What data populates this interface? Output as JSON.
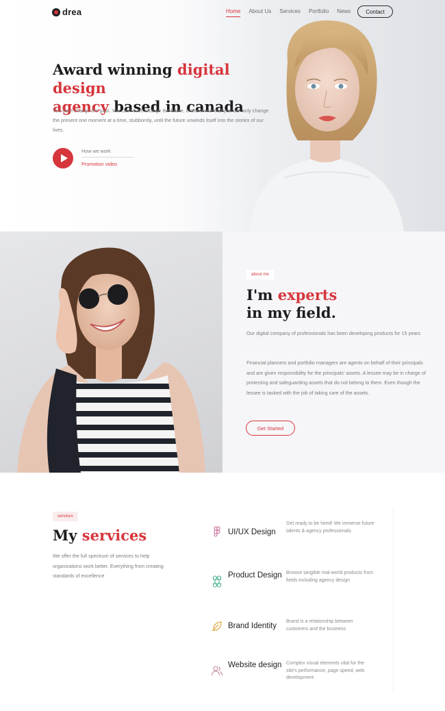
{
  "nav": {
    "logo_text": "drea",
    "items": [
      {
        "label": "Home",
        "active": true
      },
      {
        "label": "About Us",
        "active": false
      },
      {
        "label": "Services",
        "active": false
      },
      {
        "label": "Portfolio",
        "active": false
      },
      {
        "label": "News",
        "active": false
      }
    ],
    "contact_label": "Contact"
  },
  "hero": {
    "title_part1": "Award winning ",
    "title_highlight1": "digital design",
    "title_highlight2": "agency",
    "title_part2": " based in canada",
    "description": "You can't change the past. You can't even change the future, in the sense that you can only change the present one moment at a time, stubbornly, until the future unwinds itself into the stories of our lives.",
    "how_we_work": "How we work",
    "promotion_video": "Promotion video"
  },
  "about": {
    "tag": "about me",
    "title_part1": "I'm ",
    "title_highlight": "experts",
    "title_part2": "in my field.",
    "paragraph1": "Our digital company of professionals has been developing products for 15 years",
    "paragraph2": "Financial planners and portfolio managers are agents on behalf of their principals and are given responsibility for the principals' assets. A lessee may be in charge of protecting and safeguarding assets that do not belong to them. Even though the lessee is tasked with the job of taking care of the assets.",
    "button_label": "Get Started"
  },
  "services": {
    "tag": "services",
    "title_part1": "My ",
    "title_highlight": "services",
    "description": "We offer the full spectrum of services to help organizations work better. Everything from creating standards of excellence",
    "items": [
      {
        "name": "UI/UX Design",
        "icon": "figma-icon",
        "desc": "Get ready to be hired! We immerse future talents & agency professionals"
      },
      {
        "name": "Product Design",
        "icon": "command-icon",
        "desc": "Browse tangible real-world products from fields including agency design"
      },
      {
        "name": "Brand Identity",
        "icon": "feather-icon",
        "desc": "Brand is a relationship between customers and the business"
      },
      {
        "name": "Website design",
        "icon": "users-icon",
        "desc": "Complex visual elements vital for the site's performance, page speed, web development"
      }
    ]
  },
  "colors": {
    "accent": "#d6353c",
    "text": "#1d1d1f",
    "muted": "#7c7c7c"
  }
}
